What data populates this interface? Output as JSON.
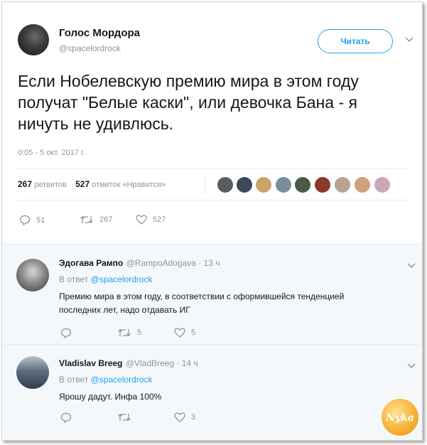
{
  "tweet": {
    "author_name": "Голос Мордора",
    "author_handle": "@spacelordrock",
    "follow_label": "Читать",
    "text": "Если Нобелевскую премию мира в этом году получат \"Белые каски\", или девочка Бана - я ничуть не удивлюсь.",
    "timestamp": "0:05 - 5 окт. 2017 г.",
    "retweets_count": "267",
    "retweets_label": "ретвитов",
    "likes_count": "527",
    "likes_label": "отметок «Нравится»",
    "actions": {
      "reply": "51",
      "retweet": "267",
      "like": "527"
    }
  },
  "replies": [
    {
      "name": "Эдогава Рампо",
      "handle": "@RampoAdogava · 13 ч",
      "in_reply_prefix": "В ответ",
      "in_reply_to": "@spacelordrock",
      "text_line1": "Премию мира в этом году, в соответствии с оформившейся тенденцией",
      "text_line2": "последних лет, надо отдавать ИГ",
      "actions": {
        "reply": "",
        "retweet": "5",
        "like": "5"
      }
    },
    {
      "name": "Vladislav Breeg",
      "handle": "@VladBreeg · 14 ч",
      "in_reply_prefix": "В ответ",
      "in_reply_to": "@spacelordrock",
      "text_line1": "Ярошу дадут. Инфа 100%",
      "actions": {
        "reply": "",
        "retweet": "",
        "like": "3"
      }
    }
  ],
  "colors": {
    "accent": "#1da1f2",
    "muted": "#8a969f",
    "text": "#14171a",
    "reply_bg": "#f5f8fa"
  },
  "watermark_logo": "Nyka"
}
